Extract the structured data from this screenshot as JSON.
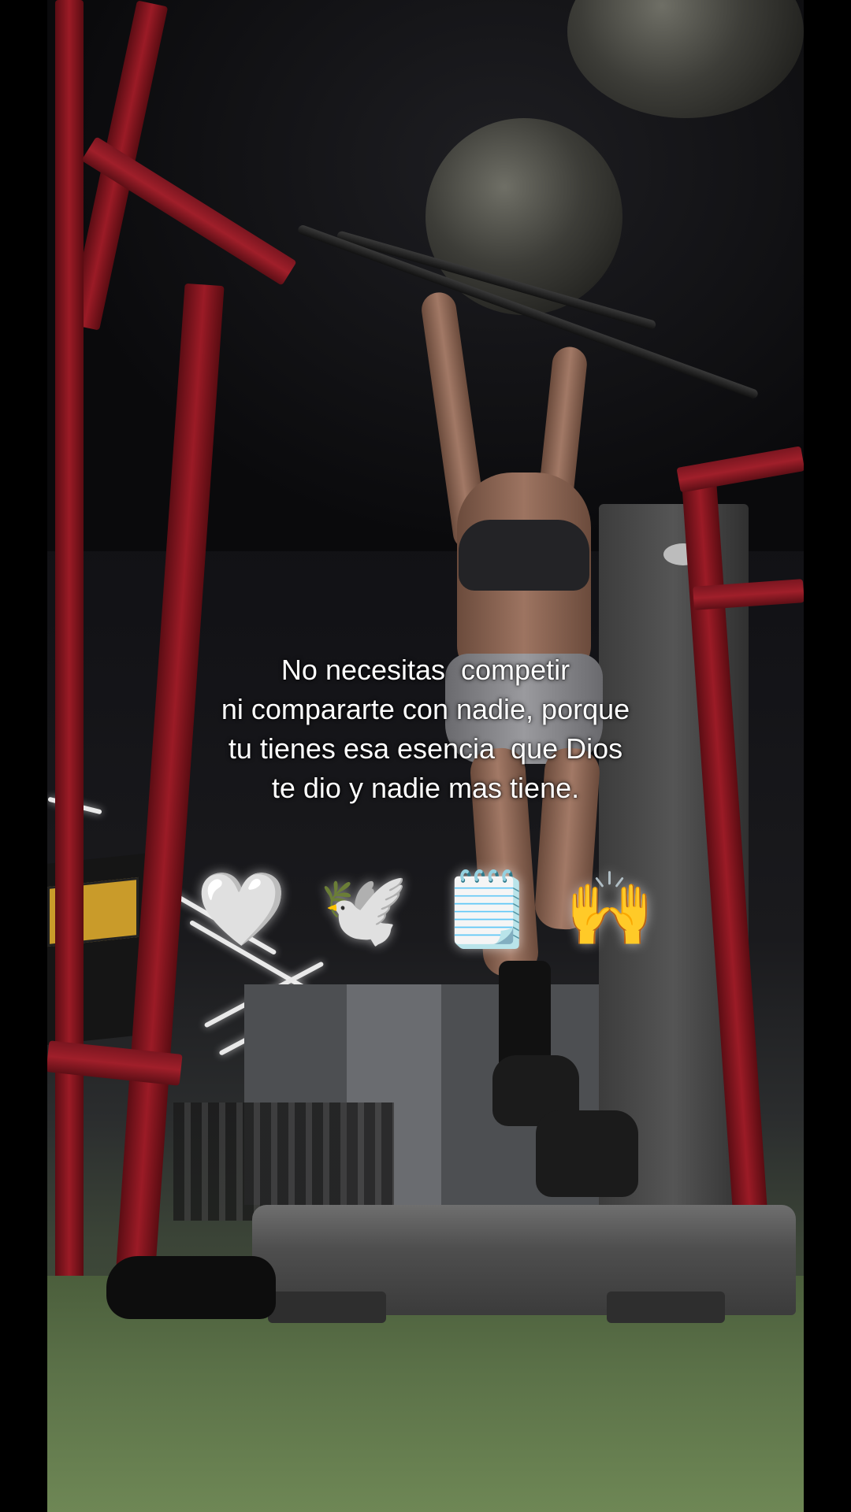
{
  "caption": {
    "lines": [
      "No necesitas  competir",
      "ni compararte con nadie, porque",
      "tu tienes esa esencia  que Dios",
      "te dio y nadie mas tiene."
    ]
  },
  "emojis": [
    {
      "name": "white-heart-icon",
      "glyph": "🤍"
    },
    {
      "name": "dove-icon",
      "glyph": "🕊️"
    },
    {
      "name": "notepad-icon",
      "glyph": "🗒️"
    },
    {
      "name": "raising-hands-icon",
      "glyph": "🙌"
    }
  ],
  "colors": {
    "rack_red": "#9b1b26",
    "floor_green": "#5b7148",
    "caption_text": "#ffffff"
  }
}
